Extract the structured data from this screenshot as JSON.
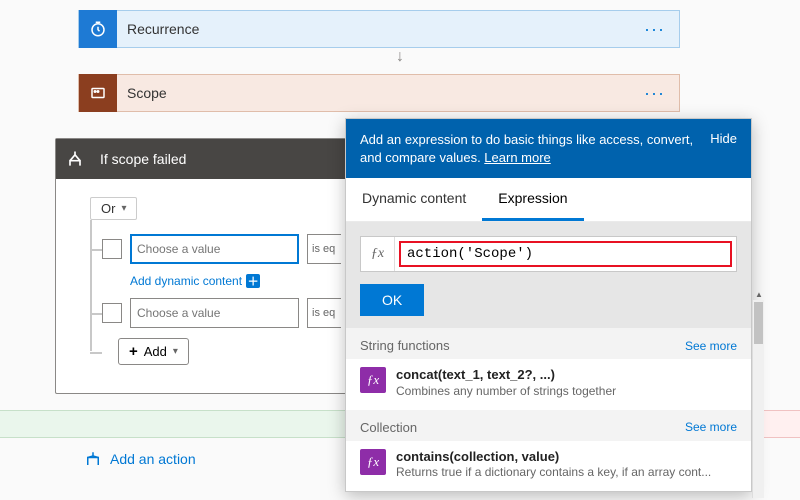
{
  "cards": {
    "recurrence": {
      "title": "Recurrence"
    },
    "scope": {
      "title": "Scope"
    },
    "condition": {
      "title": "If scope failed"
    }
  },
  "condition": {
    "group_op": "Or",
    "row1_placeholder": "Choose a value",
    "row1_op": "is eq",
    "row2_placeholder": "Choose a value",
    "row2_op": "is eq",
    "add_dyn": "Add dynamic content",
    "add_label": "Add"
  },
  "bottom": {
    "add_action": "Add an action"
  },
  "panel": {
    "header_msg": "Add an expression to do basic things like access, convert, and compare values. ",
    "learn_more": "Learn more",
    "hide": "Hide",
    "tab_dynamic": "Dynamic content",
    "tab_expression": "Expression",
    "expression_value": "action('Scope')",
    "ok": "OK",
    "categories": [
      {
        "label": "String functions",
        "more": "See more"
      },
      {
        "label": "Collection",
        "more": "See more"
      }
    ],
    "functions": [
      {
        "sig": "concat(text_1, text_2?, ...)",
        "desc": "Combines any number of strings together"
      },
      {
        "sig": "contains(collection, value)",
        "desc": "Returns true if a dictionary contains a key, if an array cont..."
      }
    ]
  }
}
